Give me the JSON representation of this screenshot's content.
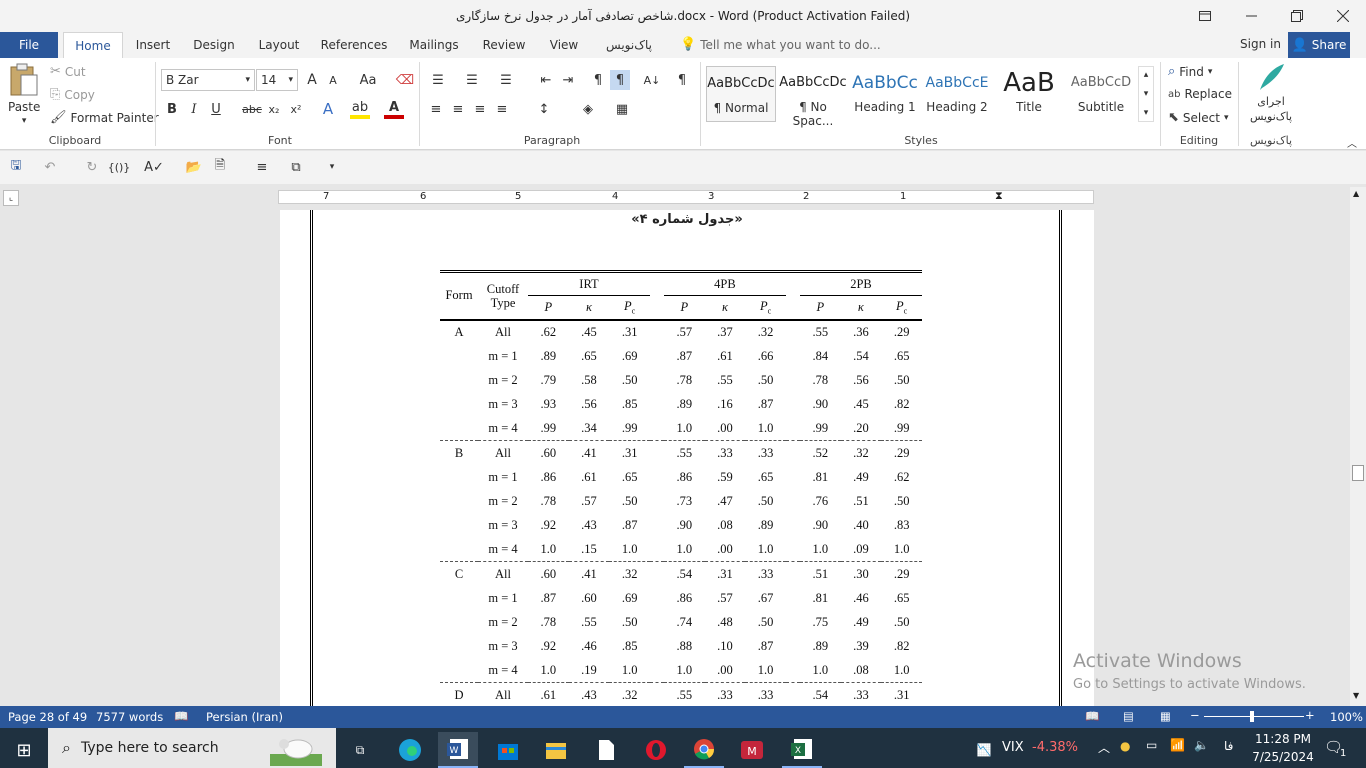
{
  "window": {
    "title": "شاخص تصادفی آمار در جدول نرخ سازگاری.docx  -  Word (Product Activation Failed)"
  },
  "tabs": [
    "File",
    "Home",
    "Insert",
    "Design",
    "Layout",
    "References",
    "Mailings",
    "Review",
    "View",
    "پاک‌نویس"
  ],
  "tell_me": "Tell me what you want to do...",
  "sign_in": "Sign in",
  "share": "Share",
  "clipboard": {
    "paste": "Paste",
    "cut": "Cut",
    "copy": "Copy",
    "format_painter": "Format Painter",
    "label": "Clipboard"
  },
  "font": {
    "name": "B Zar",
    "size": "14",
    "label": "Font",
    "grow": "A",
    "shrink": "A",
    "case": "Aa"
  },
  "paragraph": {
    "label": "Paragraph"
  },
  "styles": {
    "label": "Styles",
    "items": [
      {
        "preview": "AaBbCcDc",
        "name": "¶ Normal"
      },
      {
        "preview": "AaBbCcDc",
        "name": "¶ No Spac..."
      },
      {
        "preview": "AaBbCc",
        "name": "Heading 1"
      },
      {
        "preview": "AaBbCcE",
        "name": "Heading 2"
      },
      {
        "preview": "AaB",
        "name": "Title"
      },
      {
        "preview": "AaBbCcD",
        "name": "Subtitle"
      }
    ]
  },
  "editing": {
    "find": "Find",
    "replace": "Replace",
    "select": "Select",
    "label": "Editing"
  },
  "pak": {
    "run": "اجرای پاک‌نویس",
    "label": "پاک‌نویس"
  },
  "ruler": [
    "7",
    "6",
    "5",
    "4",
    "3",
    "2",
    "1"
  ],
  "doc": {
    "caption": "«جدول شماره ۴»",
    "table": {
      "col_form": "Form",
      "col_cutoff": "Cutoff Type",
      "groups": [
        "IRT",
        "4PB",
        "2PB"
      ],
      "sub": [
        "P",
        "κ",
        "P"
      ],
      "rows": [
        [
          "A",
          "All",
          ".62",
          ".45",
          ".31",
          ".57",
          ".37",
          ".32",
          ".55",
          ".36",
          ".29"
        ],
        [
          "",
          "m = 1",
          ".89",
          ".65",
          ".69",
          ".87",
          ".61",
          ".66",
          ".84",
          ".54",
          ".65"
        ],
        [
          "",
          "m = 2",
          ".79",
          ".58",
          ".50",
          ".78",
          ".55",
          ".50",
          ".78",
          ".56",
          ".50"
        ],
        [
          "",
          "m = 3",
          ".93",
          ".56",
          ".85",
          ".89",
          ".16",
          ".87",
          ".90",
          ".45",
          ".82"
        ],
        [
          "",
          "m = 4",
          ".99",
          ".34",
          ".99",
          "1.0",
          ".00",
          "1.0",
          ".99",
          ".20",
          ".99"
        ],
        [
          "B",
          "All",
          ".60",
          ".41",
          ".31",
          ".55",
          ".33",
          ".33",
          ".52",
          ".32",
          ".29"
        ],
        [
          "",
          "m = 1",
          ".86",
          ".61",
          ".65",
          ".86",
          ".59",
          ".65",
          ".81",
          ".49",
          ".62"
        ],
        [
          "",
          "m = 2",
          ".78",
          ".57",
          ".50",
          ".73",
          ".47",
          ".50",
          ".76",
          ".51",
          ".50"
        ],
        [
          "",
          "m = 3",
          ".92",
          ".43",
          ".87",
          ".90",
          ".08",
          ".89",
          ".90",
          ".40",
          ".83"
        ],
        [
          "",
          "m = 4",
          "1.0",
          ".15",
          "1.0",
          "1.0",
          ".00",
          "1.0",
          "1.0",
          ".09",
          "1.0"
        ],
        [
          "C",
          "All",
          ".60",
          ".41",
          ".32",
          ".54",
          ".31",
          ".33",
          ".51",
          ".30",
          ".29"
        ],
        [
          "",
          "m = 1",
          ".87",
          ".60",
          ".69",
          ".86",
          ".57",
          ".67",
          ".81",
          ".46",
          ".65"
        ],
        [
          "",
          "m = 2",
          ".78",
          ".55",
          ".50",
          ".74",
          ".48",
          ".50",
          ".75",
          ".49",
          ".50"
        ],
        [
          "",
          "m = 3",
          ".92",
          ".46",
          ".85",
          ".88",
          ".10",
          ".87",
          ".89",
          ".39",
          ".82"
        ],
        [
          "",
          "m = 4",
          "1.0",
          ".19",
          "1.0",
          "1.0",
          ".00",
          "1.0",
          "1.0",
          ".08",
          "1.0"
        ],
        [
          "D",
          "All",
          ".61",
          ".43",
          ".32",
          ".55",
          ".33",
          ".33",
          ".54",
          ".33",
          ".31"
        ]
      ]
    }
  },
  "watermark": {
    "line1": "Activate Windows",
    "line2": "Go to Settings to activate Windows."
  },
  "status": {
    "page": "Page 28 of 49",
    "words": "7577 words",
    "language": "Persian (Iran)",
    "zoom": "100%"
  },
  "taskbar": {
    "search": "Type here to search",
    "vix_label": "VIX",
    "vix_value": "-4.38%",
    "lang": "فا",
    "time": "11:28 PM",
    "date": "7/25/2024",
    "notif": "1"
  },
  "colors": {
    "accent": "#2b579a",
    "taskbar": "#1f3140",
    "vix_neg": "#ff6b6b"
  }
}
